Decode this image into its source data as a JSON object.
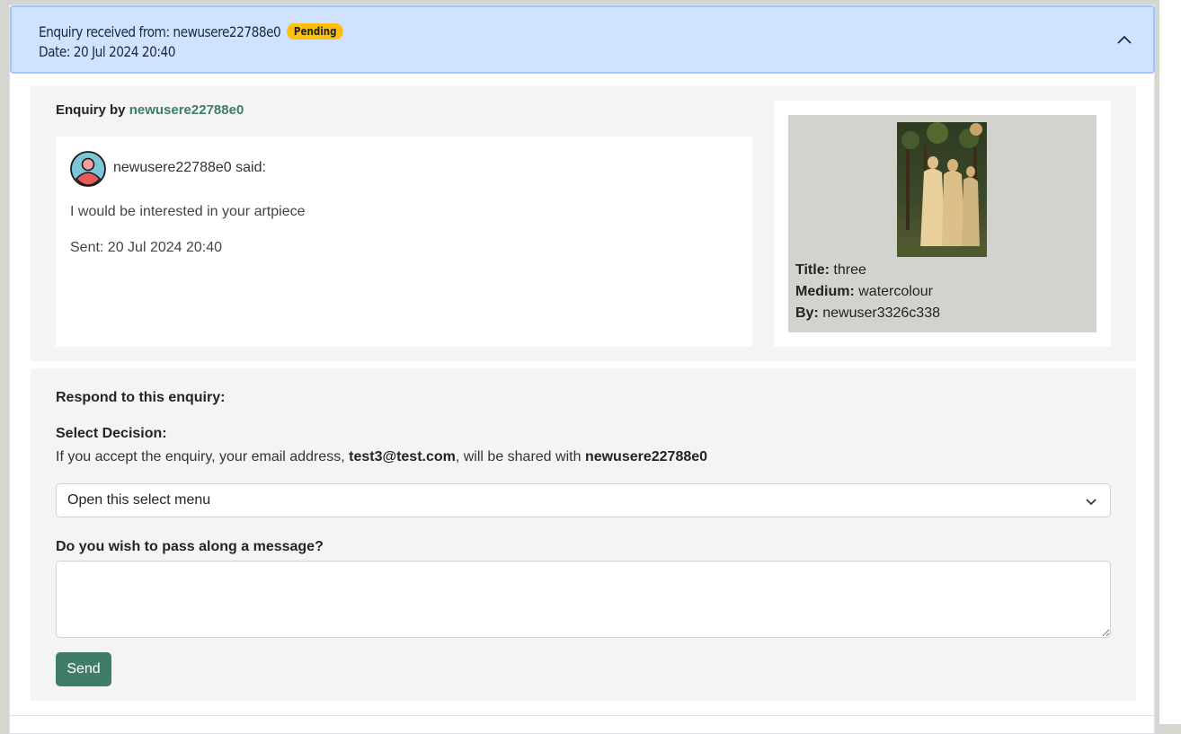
{
  "header": {
    "received_from": "Enquiry received from: newusere22788e0",
    "status_badge": "Pending",
    "date": "Date: 20 Jul 2024 20:40",
    "toggle_icon": "chevron-up-icon"
  },
  "enquiry": {
    "by_label": "Enquiry by",
    "by_user": "newusere22788e0",
    "said": "newusere22788e0 said:",
    "message": "I would be interested in your artpiece",
    "sent": "Sent: 20 Jul 2024 20:40",
    "avatar_icon": "user-avatar-icon"
  },
  "artwork": {
    "title_label": "Title:",
    "title": "three",
    "medium_label": "Medium:",
    "medium": "watercolour",
    "by_label": "By:",
    "by": "newuser3326c338"
  },
  "respond": {
    "heading": "Respond to this enquiry:",
    "decision_label": "Select Decision:",
    "info_prefix": "If you accept the enquiry, your email address,",
    "email": "test3@test.com",
    "info_middle": ", will be shared with",
    "share_user": "newusere22788e0",
    "select_value": "Open this select menu",
    "message_label": "Do you wish to pass along a message?",
    "message_value": "",
    "send_label": "Send"
  },
  "colors": {
    "accent": "#3f7c6a",
    "header_bg": "#cfe2ff",
    "badge": "#ffc107",
    "panel_bg": "#f3f4f3"
  }
}
